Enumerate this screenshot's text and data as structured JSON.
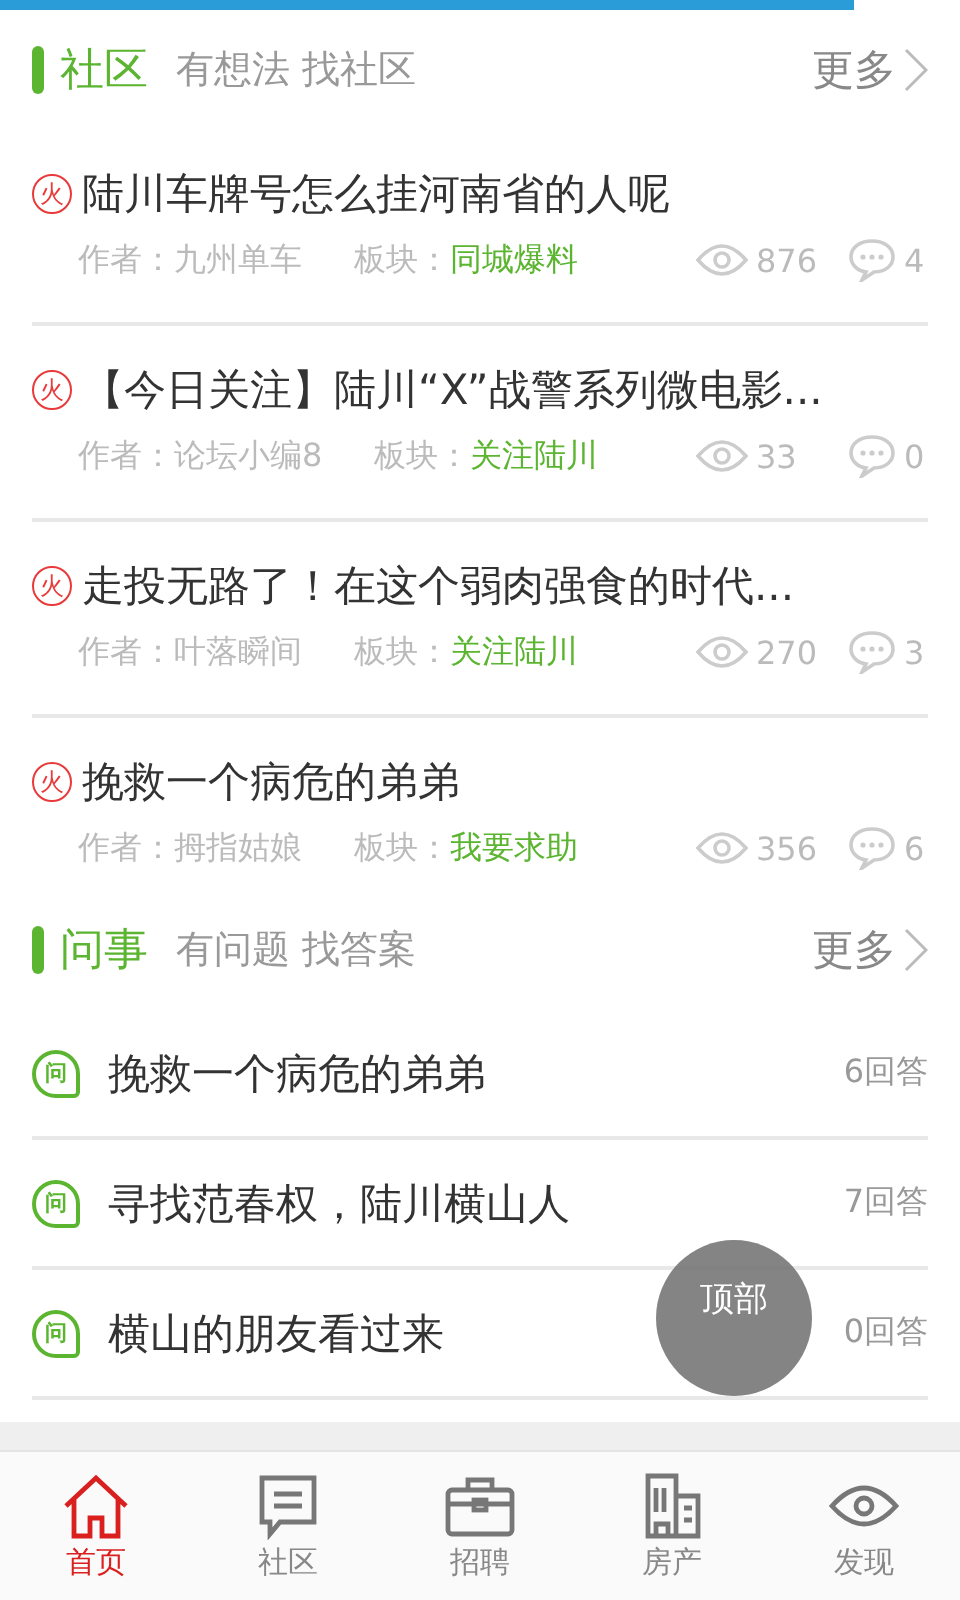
{
  "load_progress": {
    "level": 0.89
  },
  "sections": [
    {
      "kind": "posts",
      "title": "社区",
      "subtitle": "有想法 找社区",
      "more": "更多",
      "items": [
        {
          "badge": "火",
          "title": "陆川车牌号怎么挂河南省的人呢",
          "author_label": "作者：",
          "author": "九州单车",
          "board_label": "板块：",
          "board": "同城爆料",
          "views": "876",
          "comments": "4"
        },
        {
          "badge": "火",
          "title": "【今日关注】陆川“X”战警系列微电影...",
          "author_label": "作者：",
          "author": "论坛小编8",
          "board_label": "板块：",
          "board": "关注陆川",
          "views": "33",
          "comments": "0"
        },
        {
          "badge": "火",
          "title": "走投无路了！在这个弱肉强食的时代...",
          "author_label": "作者：",
          "author": "叶落瞬间",
          "board_label": "板块：",
          "board": "关注陆川",
          "views": "270",
          "comments": "3"
        },
        {
          "badge": "火",
          "title": "挽救一个病危的弟弟",
          "author_label": "作者：",
          "author": "拇指姑娘",
          "board_label": "板块：",
          "board": "我要求助",
          "views": "356",
          "comments": "6"
        }
      ]
    },
    {
      "kind": "questions",
      "title": "问事",
      "subtitle": "有问题 找答案",
      "more": "更多",
      "items": [
        {
          "badge": "问",
          "title": "挽救一个病危的弟弟",
          "answers": "6回答"
        },
        {
          "badge": "问",
          "title": "寻找范春权，陆川横山人",
          "answers": "7回答"
        },
        {
          "badge": "问",
          "title": "横山的朋友看过来",
          "answers": "0回答"
        }
      ]
    }
  ],
  "back_to_top": "顶部",
  "tabs": [
    {
      "label": "首页",
      "selected": true
    },
    {
      "label": "社区",
      "selected": false
    },
    {
      "label": "招聘",
      "selected": false
    },
    {
      "label": "房产",
      "selected": false
    },
    {
      "label": "发现",
      "selected": false
    }
  ]
}
